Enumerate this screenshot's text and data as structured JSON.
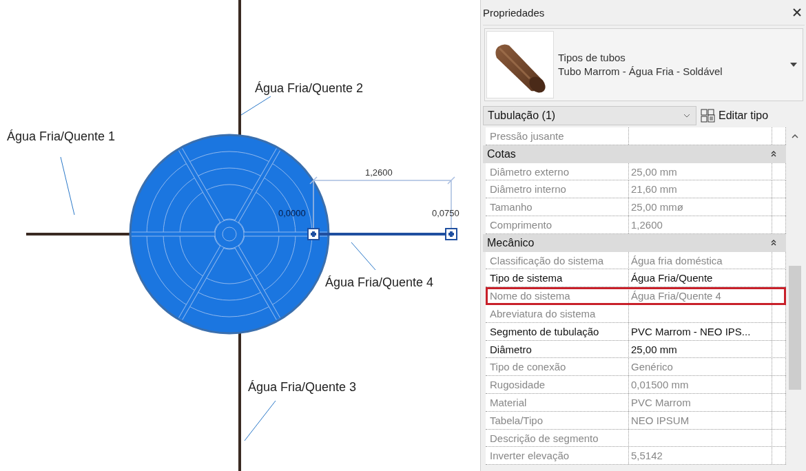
{
  "canvas": {
    "labels": [
      "Água Fria/Quente 2",
      "Água Fria/Quente 1",
      "Água Fria/Quente 4",
      "Água Fria/Quente 3"
    ],
    "dimension": "1,2600",
    "offsets": [
      "0,0000",
      "0,0750"
    ]
  },
  "panel": {
    "title": "Propriedades",
    "type_selector": {
      "family": "Tipos de tubos",
      "type": "Tubo Marrom - Água Fria - Soldável"
    },
    "instance_filter": "Tubulação (1)",
    "edit_type_button": "Editar tipo",
    "rows": [
      {
        "kind": "property",
        "label": "Pressão jusante",
        "value": "",
        "editable": false,
        "highlighted": false
      },
      {
        "kind": "group",
        "label": "Cotas",
        "expanded": true
      },
      {
        "kind": "property",
        "label": "Diâmetro externo",
        "value": "25,00 mm",
        "editable": false,
        "highlighted": false
      },
      {
        "kind": "property",
        "label": "Diâmetro interno",
        "value": "21,60 mm",
        "editable": false,
        "highlighted": false
      },
      {
        "kind": "property",
        "label": "Tamanho",
        "value": "25,00 mmø",
        "editable": false,
        "highlighted": false
      },
      {
        "kind": "property",
        "label": "Comprimento",
        "value": "1,2600",
        "editable": false,
        "highlighted": false
      },
      {
        "kind": "group",
        "label": "Mecânico",
        "expanded": true
      },
      {
        "kind": "property",
        "label": "Classificação do sistema",
        "value": "Água fria doméstica",
        "editable": false,
        "highlighted": false
      },
      {
        "kind": "property",
        "label": "Tipo de sistema",
        "value": "Água Fria/Quente",
        "editable": true,
        "highlighted": false
      },
      {
        "kind": "property",
        "label": "Nome do sistema",
        "value": "Água Fria/Quente 4",
        "editable": false,
        "highlighted": true
      },
      {
        "kind": "property",
        "label": "Abreviatura do sistema",
        "value": "",
        "editable": false,
        "highlighted": false
      },
      {
        "kind": "property",
        "label": "Segmento de tubulação",
        "value": "PVC Marrom - NEO IPS...",
        "editable": true,
        "highlighted": false
      },
      {
        "kind": "property",
        "label": "Diâmetro",
        "value": "25,00 mm",
        "editable": true,
        "highlighted": false
      },
      {
        "kind": "property",
        "label": "Tipo de conexão",
        "value": "Genérico",
        "editable": false,
        "highlighted": false
      },
      {
        "kind": "property",
        "label": "Rugosidade",
        "value": "0,01500 mm",
        "editable": false,
        "highlighted": false
      },
      {
        "kind": "property",
        "label": "Material",
        "value": "PVC Marrom",
        "editable": false,
        "highlighted": false
      },
      {
        "kind": "property",
        "label": "Tabela/Tipo",
        "value": "NEO IPSUM",
        "editable": false,
        "highlighted": false
      },
      {
        "kind": "property",
        "label": "Descrição de segmento",
        "value": "",
        "editable": false,
        "highlighted": false
      },
      {
        "kind": "property",
        "label": "Inverter elevação",
        "value": "5,5142",
        "editable": false,
        "highlighted": false
      }
    ]
  }
}
